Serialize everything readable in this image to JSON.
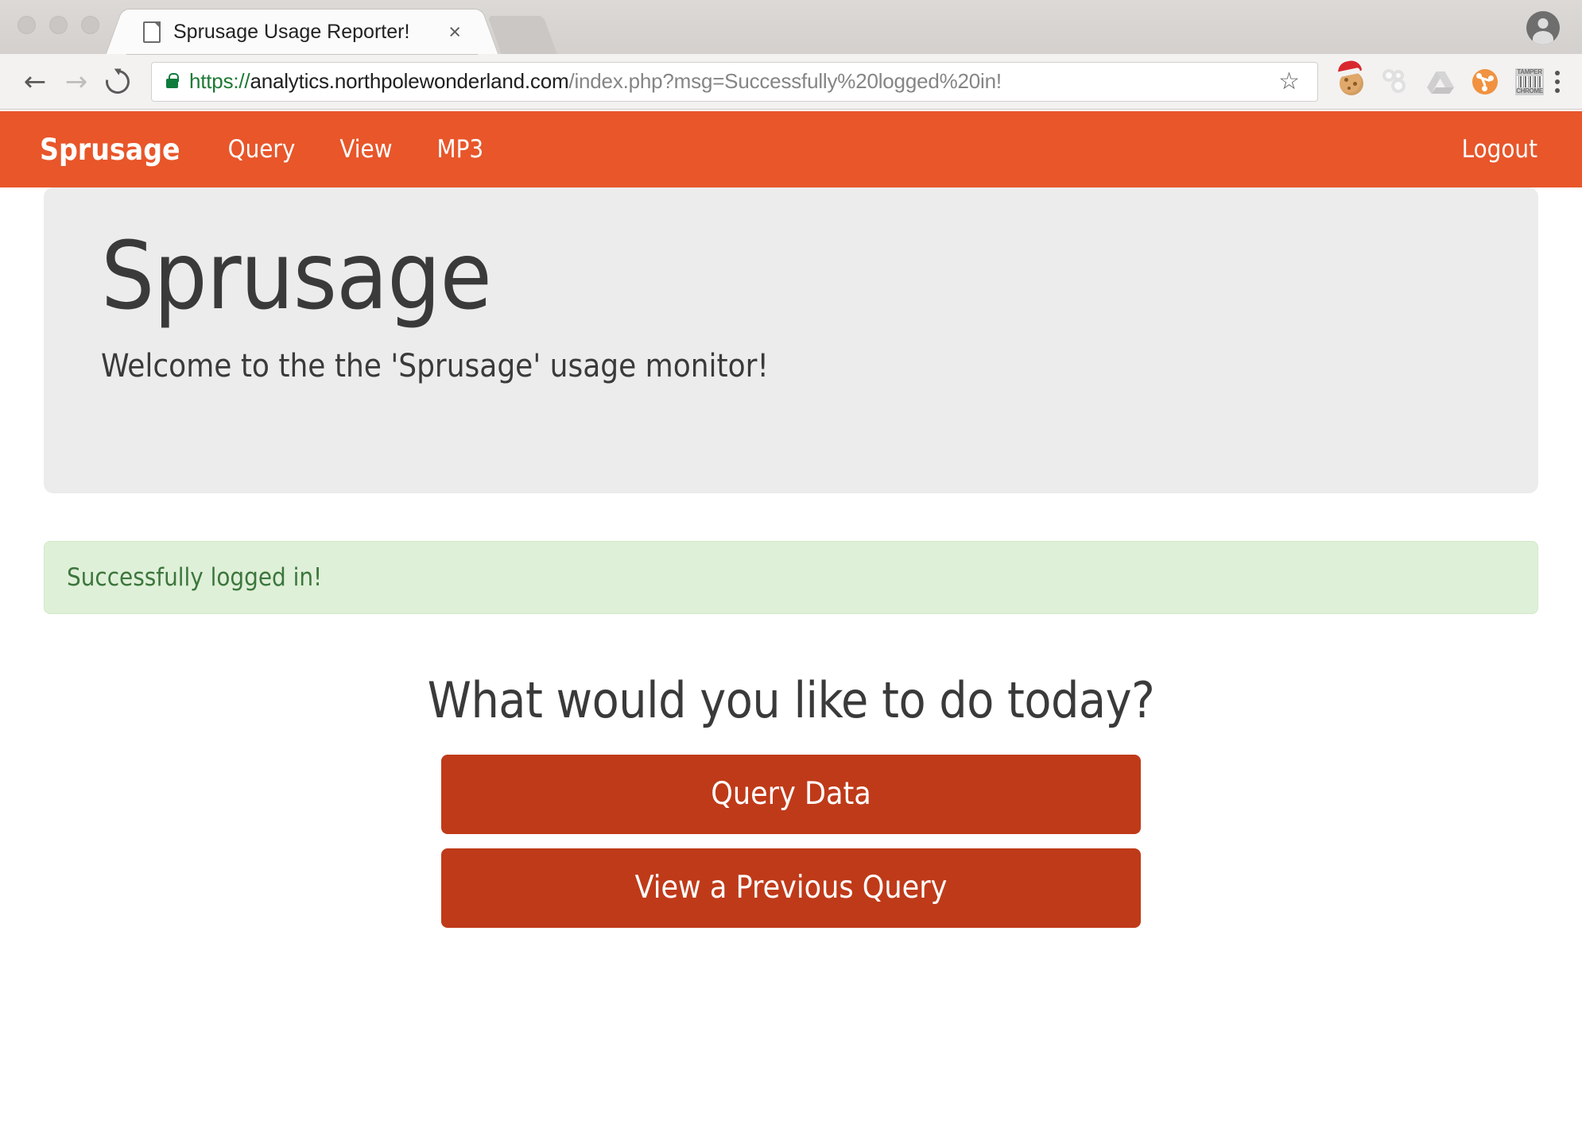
{
  "browser": {
    "tab": {
      "title": "Sprusage Usage Reporter!",
      "close_label": "×"
    },
    "toolbar": {
      "back_label": "←",
      "forward_label": "→",
      "reload_name": "reload",
      "star_label": "☆",
      "url_scheme": "https://",
      "url_host": "analytics.northpolewonderland.com",
      "url_path": "/index.php?msg=Successfully%20logged%20in!",
      "url_full": "https://analytics.northpolewonderland.com/index.php?msg=Successfully%20logged%20in!",
      "extensions": [
        {
          "name": "santa-cookie-extension-icon"
        },
        {
          "name": "bubbles-extension-icon"
        },
        {
          "name": "google-drive-extension-icon"
        },
        {
          "name": "share-node-extension-icon"
        },
        {
          "name": "tamper-chrome-extension-icon",
          "line1": "TAMPER",
          "line2": "CHROME"
        }
      ]
    }
  },
  "site": {
    "navbar": {
      "brand": "Sprusage",
      "links": [
        {
          "label": "Query"
        },
        {
          "label": "View"
        },
        {
          "label": "MP3"
        }
      ],
      "logout": "Logout",
      "color": "#e8562a"
    },
    "jumbotron": {
      "heading": "Sprusage",
      "subheading": "Welcome to the the 'Sprusage' usage monitor!",
      "background": "#ececec"
    },
    "alert": {
      "message": "Successfully logged in!",
      "background": "#dff0d8",
      "text_color": "#3c763d"
    },
    "cta": {
      "heading": "What would you like to do today?",
      "buttons": [
        {
          "label": "Query Data",
          "color": "#bf3a19"
        },
        {
          "label": "View a Previous Query",
          "color": "#bf3a19"
        }
      ]
    }
  }
}
